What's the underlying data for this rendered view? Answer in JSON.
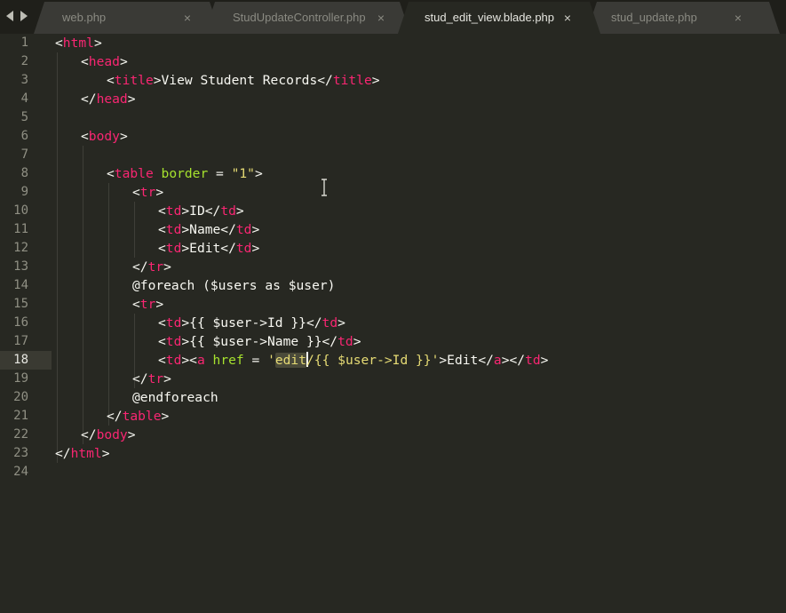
{
  "tabs": [
    {
      "label": "web.php",
      "close": "×",
      "active": false
    },
    {
      "label": "StudUpdateController.php",
      "close": "×",
      "active": false
    },
    {
      "label": "stud_edit_view.blade.php",
      "close": "×",
      "active": true
    },
    {
      "label": "stud_update.php",
      "close": "×",
      "active": false
    }
  ],
  "line_numbers": [
    "1",
    "2",
    "3",
    "4",
    "5",
    "6",
    "7",
    "8",
    "9",
    "10",
    "11",
    "12",
    "13",
    "14",
    "15",
    "16",
    "17",
    "18",
    "19",
    "20",
    "21",
    "22",
    "23",
    "24"
  ],
  "current_line": "18",
  "code": [
    [
      [
        "p",
        "<"
      ],
      [
        "t",
        "html"
      ],
      [
        "p",
        ">"
      ]
    ],
    [
      [
        "p",
        "<"
      ],
      [
        "t",
        "head"
      ],
      [
        "p",
        ">"
      ]
    ],
    [
      [
        "p",
        "<"
      ],
      [
        "t",
        "title"
      ],
      [
        "p",
        ">View Student Records</"
      ],
      [
        "t",
        "title"
      ],
      [
        "p",
        ">"
      ]
    ],
    [
      [
        "p",
        "</"
      ],
      [
        "t",
        "head"
      ],
      [
        "p",
        ">"
      ]
    ],
    [],
    [
      [
        "p",
        "<"
      ],
      [
        "t",
        "body"
      ],
      [
        "p",
        ">"
      ]
    ],
    [],
    [
      [
        "p",
        "<"
      ],
      [
        "t",
        "table"
      ],
      [
        "p",
        " "
      ],
      [
        "a",
        "border"
      ],
      [
        "p",
        " = "
      ],
      [
        "s",
        "\"1\""
      ],
      [
        "p",
        ">"
      ]
    ],
    [
      [
        "p",
        "<"
      ],
      [
        "t",
        "tr"
      ],
      [
        "p",
        ">"
      ]
    ],
    [
      [
        "p",
        "<"
      ],
      [
        "t",
        "td"
      ],
      [
        "p",
        ">ID</"
      ],
      [
        "t",
        "td"
      ],
      [
        "p",
        ">"
      ]
    ],
    [
      [
        "p",
        "<"
      ],
      [
        "t",
        "td"
      ],
      [
        "p",
        ">Name</"
      ],
      [
        "t",
        "td"
      ],
      [
        "p",
        ">"
      ]
    ],
    [
      [
        "p",
        "<"
      ],
      [
        "t",
        "td"
      ],
      [
        "p",
        ">Edit</"
      ],
      [
        "t",
        "td"
      ],
      [
        "p",
        ">"
      ]
    ],
    [
      [
        "p",
        "</"
      ],
      [
        "t",
        "tr"
      ],
      [
        "p",
        ">"
      ]
    ],
    [
      [
        "p",
        "@foreach ($users as $user)"
      ]
    ],
    [
      [
        "p",
        "<"
      ],
      [
        "t",
        "tr"
      ],
      [
        "p",
        ">"
      ]
    ],
    [
      [
        "p",
        "<"
      ],
      [
        "t",
        "td"
      ],
      [
        "p",
        ">{{ $user->Id }}</"
      ],
      [
        "t",
        "td"
      ],
      [
        "p",
        ">"
      ]
    ],
    [
      [
        "p",
        "<"
      ],
      [
        "t",
        "td"
      ],
      [
        "p",
        ">{{ $user->Name }}</"
      ],
      [
        "t",
        "td"
      ],
      [
        "p",
        ">"
      ]
    ],
    [
      [
        "p",
        "<"
      ],
      [
        "t",
        "td"
      ],
      [
        "p",
        "><"
      ],
      [
        "t",
        "a"
      ],
      [
        "p",
        " "
      ],
      [
        "a",
        "href"
      ],
      [
        "p",
        " = "
      ],
      [
        "s",
        "'"
      ],
      [
        "hl",
        "edit"
      ],
      [
        "caret",
        ""
      ],
      [
        "s",
        "/{{ $user->Id }}'"
      ],
      [
        "p",
        ">Edit</"
      ],
      [
        "t",
        "a"
      ],
      [
        "p",
        "></"
      ],
      [
        "t",
        "td"
      ],
      [
        "p",
        ">"
      ]
    ],
    [
      [
        "p",
        "</"
      ],
      [
        "t",
        "tr"
      ],
      [
        "p",
        ">"
      ]
    ],
    [
      [
        "p",
        "@endforeach"
      ]
    ],
    [
      [
        "p",
        "</"
      ],
      [
        "t",
        "table"
      ],
      [
        "p",
        ">"
      ]
    ],
    [
      [
        "p",
        "</"
      ],
      [
        "t",
        "body"
      ],
      [
        "p",
        ">"
      ]
    ],
    [
      [
        "p",
        "</"
      ],
      [
        "t",
        "html"
      ],
      [
        "p",
        ">"
      ]
    ],
    []
  ],
  "icons": {
    "back": "arrow-left-icon",
    "forward": "arrow-right-icon",
    "cursor": "text-cursor-icon"
  },
  "colors": {
    "background": "#272822",
    "tag": "#f92672",
    "attribute": "#a6e22e",
    "string": "#e6db74",
    "text": "#f8f8f2"
  }
}
